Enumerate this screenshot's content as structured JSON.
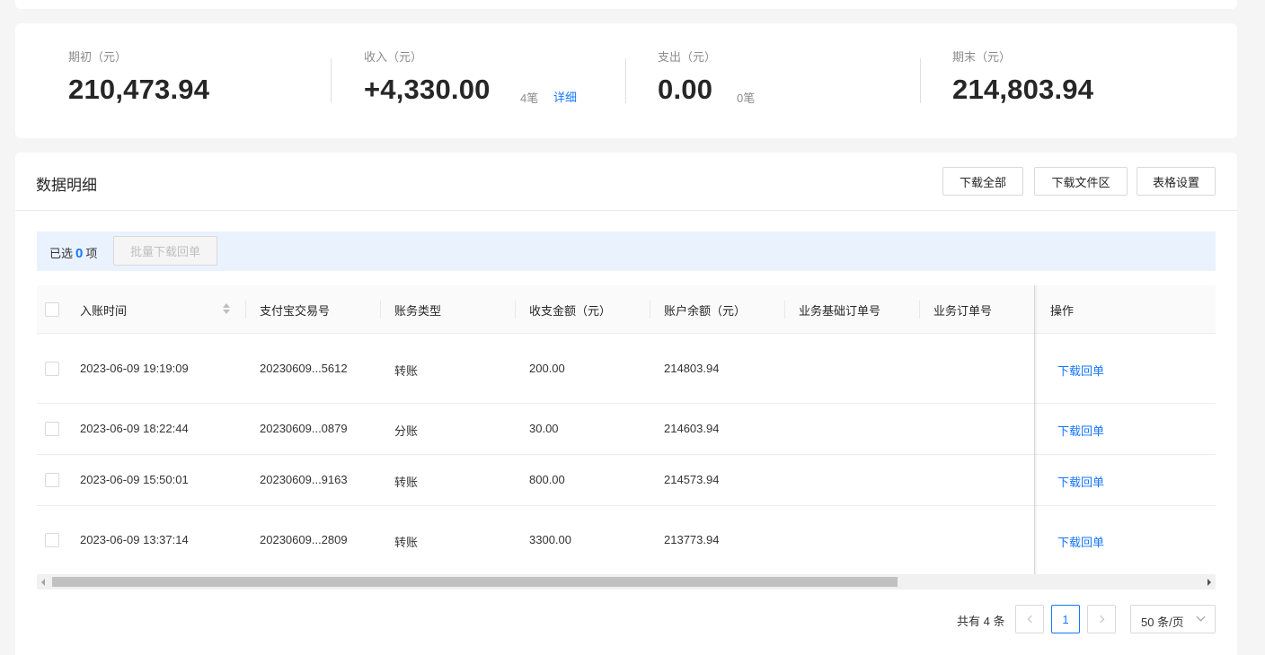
{
  "summary": {
    "opening": {
      "label": "期初（元）",
      "value": "210,473.94"
    },
    "income": {
      "label": "收入（元）",
      "value": "+4,330.00",
      "count": "4笔",
      "detail": "详细"
    },
    "expense": {
      "label": "支出（元）",
      "value": "0.00",
      "count": "0笔"
    },
    "closing": {
      "label": "期末（元）",
      "value": "214,803.94"
    }
  },
  "panel": {
    "title": "数据明细",
    "buttons": {
      "download_all": "下载全部",
      "download_area": "下载文件区",
      "table_settings": "表格设置"
    }
  },
  "selection": {
    "prefix": "已选",
    "count": "0",
    "suffix": "项",
    "batch_button": "批量下载回单"
  },
  "table": {
    "columns": [
      "入账时间",
      "支付宝交易号",
      "账务类型",
      "收支金额（元）",
      "账户余额（元）",
      "业务基础订单号",
      "业务订单号",
      "操作"
    ],
    "rows": [
      {
        "time": "2023-06-09 19:19:09",
        "trade_no": "20230609...5612",
        "type": "转账",
        "amount": "200.00",
        "balance": "214803.94",
        "base_order": "",
        "order": "",
        "action": "下载回单"
      },
      {
        "time": "2023-06-09 18:22:44",
        "trade_no": "20230609...0879",
        "type": "分账",
        "amount": "30.00",
        "balance": "214603.94",
        "base_order": "",
        "order": "",
        "action": "下载回单"
      },
      {
        "time": "2023-06-09 15:50:01",
        "trade_no": "20230609...9163",
        "type": "转账",
        "amount": "800.00",
        "balance": "214573.94",
        "base_order": "",
        "order": "",
        "action": "下载回单"
      },
      {
        "time": "2023-06-09 13:37:14",
        "trade_no": "20230609...2809",
        "type": "转账",
        "amount": "3300.00",
        "balance": "213773.94",
        "base_order": "",
        "order": "",
        "action": "下载回单"
      }
    ]
  },
  "pagination": {
    "total": "共有 4 条",
    "current_page": "1",
    "page_size": "50 条/页"
  },
  "colors": {
    "accent": "#1677ff",
    "selection_bg": "#eaf2fe"
  },
  "icons": {
    "sort": "sort-caret-icon",
    "prev": "chevron-left-icon",
    "next": "chevron-right-icon",
    "dropdown": "chevron-down-icon"
  }
}
